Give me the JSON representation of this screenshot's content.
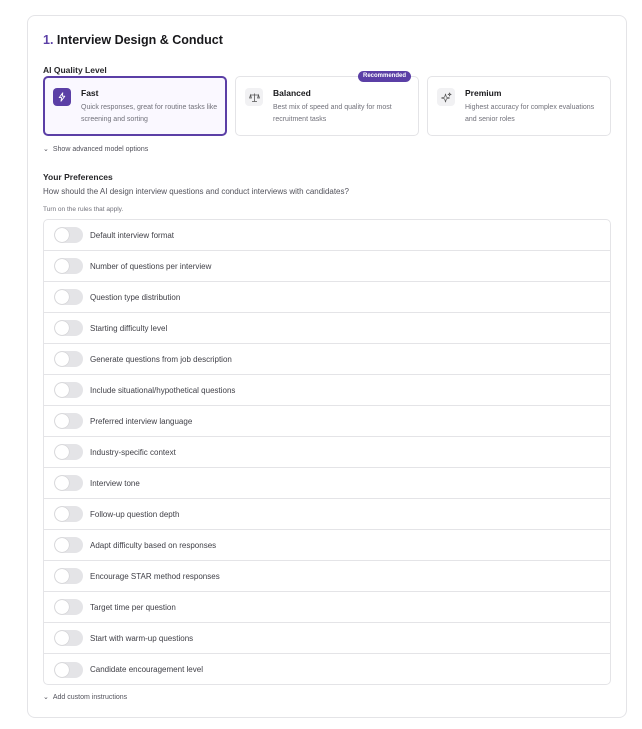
{
  "section": {
    "number": "1.",
    "title": "Interview Design & Conduct"
  },
  "quality": {
    "label": "AI Quality Level",
    "options": [
      {
        "icon": "lightning-icon",
        "title": "Fast",
        "desc": "Quick responses, great for routine tasks like screening and sorting",
        "selected": true
      },
      {
        "icon": "scale-icon",
        "title": "Balanced",
        "desc": "Best mix of speed and quality for most recruitment tasks",
        "badge": "Recommended"
      },
      {
        "icon": "sparkle-icon",
        "title": "Premium",
        "desc": "Highest accuracy for complex evaluations and senior roles"
      }
    ],
    "advanced_link": "Show advanced model options"
  },
  "preferences": {
    "title": "Your Preferences",
    "subtitle": "How should the AI design interview questions and conduct interviews with candidates?",
    "hint": "Turn on the rules that apply.",
    "rules": [
      "Default interview format",
      "Number of questions per interview",
      "Question type distribution",
      "Starting difficulty level",
      "Generate questions from job description",
      "Include situational/hypothetical questions",
      "Preferred interview language",
      "Industry-specific context",
      "Interview tone",
      "Follow-up question depth",
      "Adapt difficulty based on responses",
      "Encourage STAR method responses",
      "Target time per question",
      "Start with warm-up questions",
      "Candidate encouragement level"
    ],
    "custom_link": "Add custom instructions"
  },
  "colors": {
    "accent": "#5b3fa6",
    "border": "#e4e4e7",
    "switch_off": "#e4e4e7"
  }
}
